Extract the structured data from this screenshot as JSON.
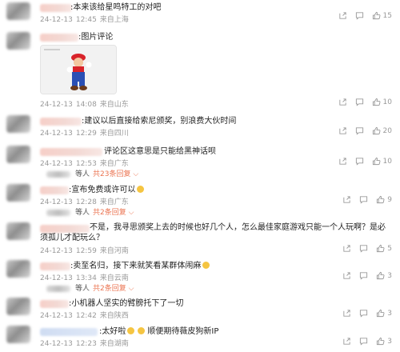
{
  "comments": [
    {
      "text": ":本来该给星鸣特工的对吧",
      "date": "24-12-13",
      "time": "12:45",
      "source": "来自上海",
      "likes": "15"
    },
    {
      "text": ":图片评论",
      "date": "24-12-13",
      "time": "14:08",
      "source": "来自山东",
      "likes": "10"
    },
    {
      "text": ":建议以后直接给索尼颁奖，别浪费大伙时间",
      "date": "24-12-13",
      "time": "12:29",
      "source": "来自四川",
      "likes": "20"
    },
    {
      "text": "评论区这意思是只能给黑神话呗",
      "date": "24-12-13",
      "time": "12:53",
      "source": "来自广东",
      "likes": "10",
      "replies": {
        "text": "等人",
        "more": "共23条回复"
      }
    },
    {
      "text": ":宣布免费或许可以",
      "date": "24-12-13",
      "time": "12:28",
      "source": "来自广东",
      "likes": "9",
      "replies": {
        "text": "等人",
        "more": "共2条回复"
      }
    },
    {
      "text": "不是，我寻思颁奖上去的时候也好几个人，怎么最佳家庭游戏只能一个人玩啊？是必须孤儿才配玩么？",
      "date": "24-12-13",
      "time": "12:59",
      "source": "来自河南",
      "likes": "5"
    },
    {
      "text": ":卖至名归，接下来就笑看某群体闹麻",
      "date": "24-12-13",
      "time": "13:34",
      "source": "来自云南",
      "likes": "3",
      "replies": {
        "text": "等人",
        "more": "共2条回复"
      }
    },
    {
      "text": ":小机器人坚实的臂膀托下了一切",
      "date": "24-12-13",
      "time": "12:42",
      "source": "来自陕西",
      "likes": "3"
    },
    {
      "text": ":太好啦",
      "text2": "顺便期待薇皮狗新IP",
      "date": "24-12-13",
      "time": "12:23",
      "source": "来自湖南",
      "likes": "3"
    }
  ],
  "icons": [
    "share-icon",
    "comment-icon",
    "like-icon"
  ],
  "colors": {
    "link": "#eb7350",
    "meta": "#9a9a9a"
  }
}
